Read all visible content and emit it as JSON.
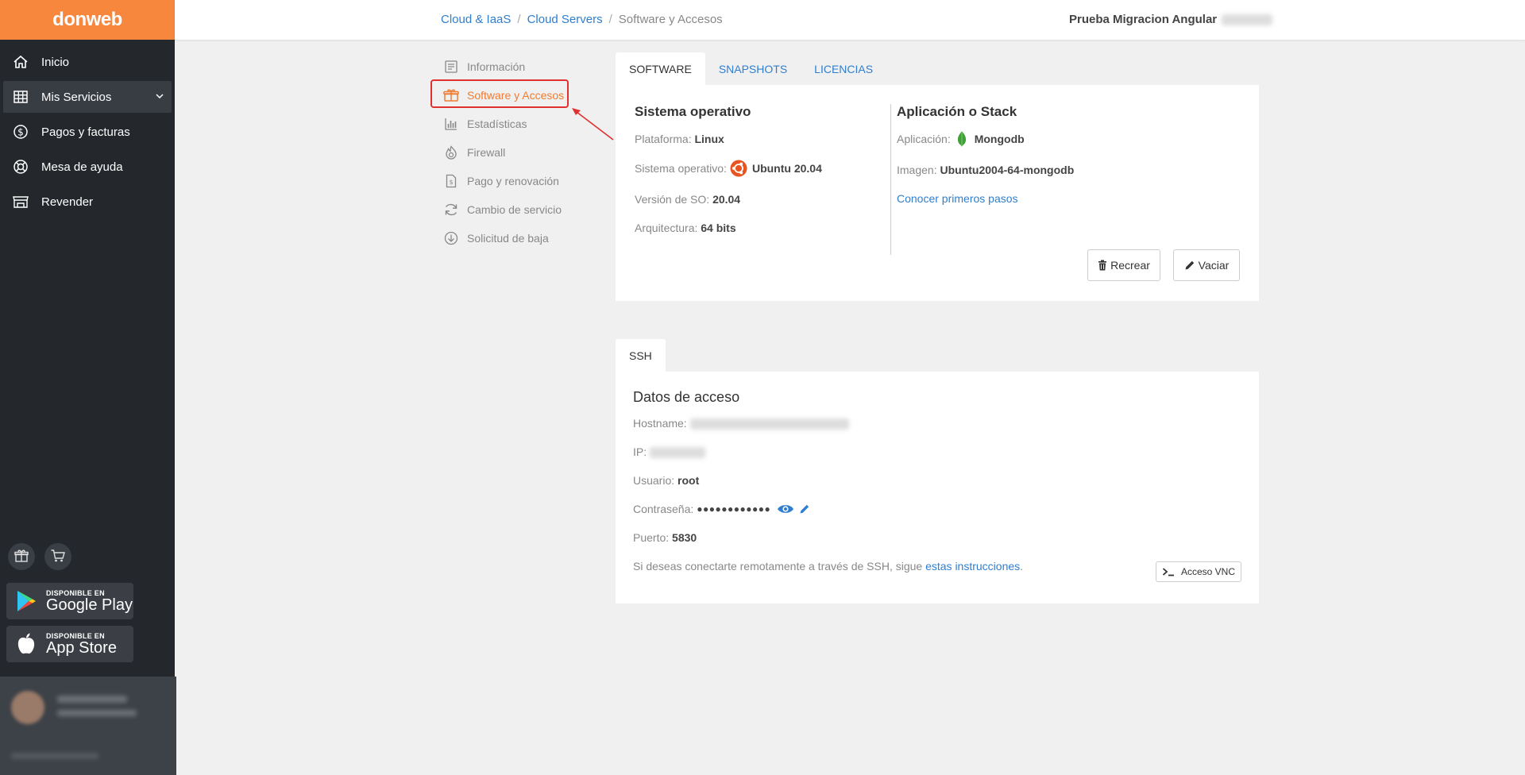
{
  "brand": {
    "logo": "donweb",
    "accent": "#f7873c"
  },
  "sidebar": {
    "items": [
      {
        "label": "Inicio",
        "icon": "home-icon"
      },
      {
        "label": "Mis Servicios",
        "icon": "grid-icon"
      },
      {
        "label": "Pagos y facturas",
        "icon": "dollar-icon"
      },
      {
        "label": "Mesa de ayuda",
        "icon": "lifebuoy-icon"
      },
      {
        "label": "Revender",
        "icon": "store-icon"
      }
    ],
    "stores": [
      {
        "small": "DISPONIBLE EN",
        "big": "Google Play"
      },
      {
        "small": "DISPONIBLE EN",
        "big": "App Store"
      }
    ]
  },
  "breadcrumb": {
    "item1": "Cloud & IaaS",
    "item2": "Cloud Servers",
    "current": "Software y Accesos",
    "separator": "/"
  },
  "account": {
    "name": "Prueba Migracion Angular"
  },
  "submenu": {
    "items": [
      {
        "label": "Información"
      },
      {
        "label": "Software y Accesos"
      },
      {
        "label": "Estadísticas"
      },
      {
        "label": "Firewall"
      },
      {
        "label": "Pago y renovación"
      },
      {
        "label": "Cambio de servicio"
      },
      {
        "label": "Solicitud de baja"
      }
    ]
  },
  "tabs_top": {
    "software": "SOFTWARE",
    "snapshots": "SNAPSHOTS",
    "licencias": "LICENCIAS"
  },
  "software": {
    "os_title": "Sistema operativo",
    "plataforma_label": "Plataforma:",
    "plataforma_value": "Linux",
    "so_label": "Sistema operativo:",
    "so_value": "Ubuntu 20.04",
    "version_label": "Versión de SO:",
    "version_value": "20.04",
    "arq_label": "Arquitectura:",
    "arq_value": "64 bits",
    "app_title": "Aplicación o Stack",
    "app_label": "Aplicación:",
    "app_value": "Mongodb",
    "imagen_label": "Imagen:",
    "imagen_value": "Ubuntu2004-64-mongodb",
    "primeros_pasos": "Conocer primeros pasos",
    "recrear": "Recrear",
    "vaciar": "Vaciar"
  },
  "tabs_ssh": {
    "ssh": "SSH"
  },
  "ssh": {
    "title": "Datos de acceso",
    "hostname_label": "Hostname:",
    "ip_label": "IP:",
    "usuario_label": "Usuario:",
    "usuario_value": "root",
    "password_label": "Contraseña:",
    "password_value": "●●●●●●●●●●●●",
    "puerto_label": "Puerto:",
    "puerto_value": "5830",
    "info_text": "Si deseas conectarte remotamente a través de SSH, sigue",
    "info_link": "estas instrucciones",
    "info_end": ".",
    "vnc": "Acceso VNC"
  }
}
